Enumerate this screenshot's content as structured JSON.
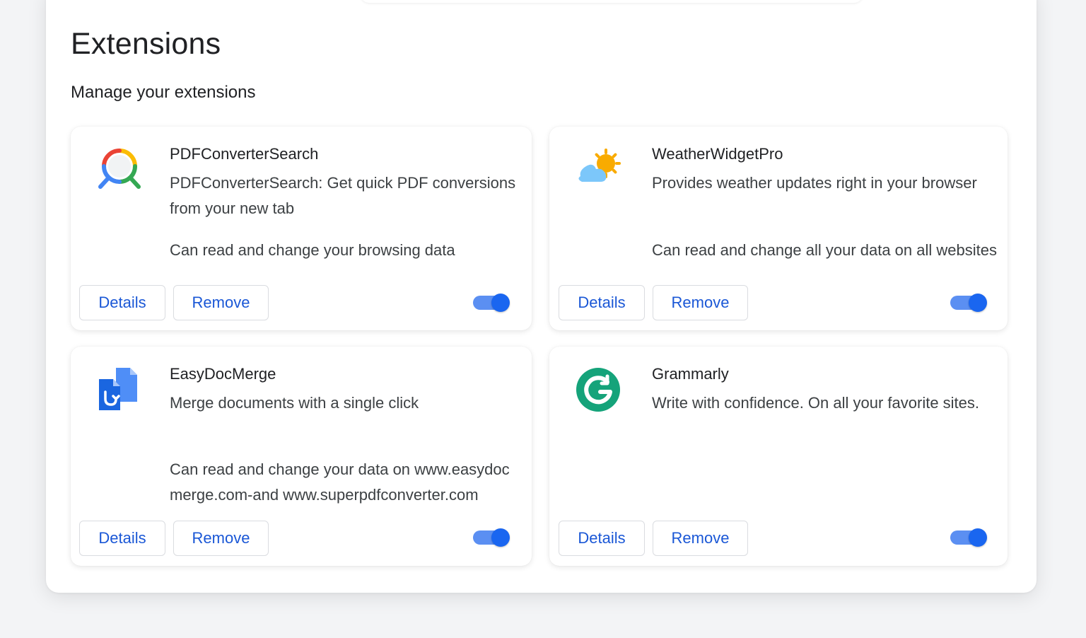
{
  "page": {
    "title": "Extensions",
    "subtitle": "Manage your extensions"
  },
  "extensions": [
    {
      "name": "PDFConverterSearch",
      "description": "PDFConverterSearch: Get quick PDF conversions from your new tab",
      "permission": "Can read and change your browsing data",
      "details_label": "Details",
      "remove_label": "Remove",
      "enabled": true,
      "icon": "magnifier-icon"
    },
    {
      "name": "WeatherWidgetPro",
      "description": "Provides weather updates right in your browser",
      "permission": "Can read and change all your data on all websites",
      "details_label": "Details",
      "remove_label": "Remove",
      "enabled": true,
      "icon": "weather-icon"
    },
    {
      "name": "EasyDocMerge",
      "description": "Merge documents with a single click",
      "permission": "Can read and change your data on www.easydocmerge.com-and www.superpdfconverter.com",
      "details_label": "Details",
      "remove_label": "Remove",
      "enabled": true,
      "icon": "document-merge-icon"
    },
    {
      "name": "Grammarly",
      "description": "Write with confidence. On all your favorite sites.",
      "permission": "",
      "details_label": "Details",
      "remove_label": "Remove",
      "enabled": true,
      "icon": "grammarly-icon"
    }
  ],
  "colors": {
    "accent": "#1a57d6",
    "toggle_on": "#1a66f0",
    "toggle_track": "#5b8ff2",
    "grammarly_green": "#15a37a"
  }
}
